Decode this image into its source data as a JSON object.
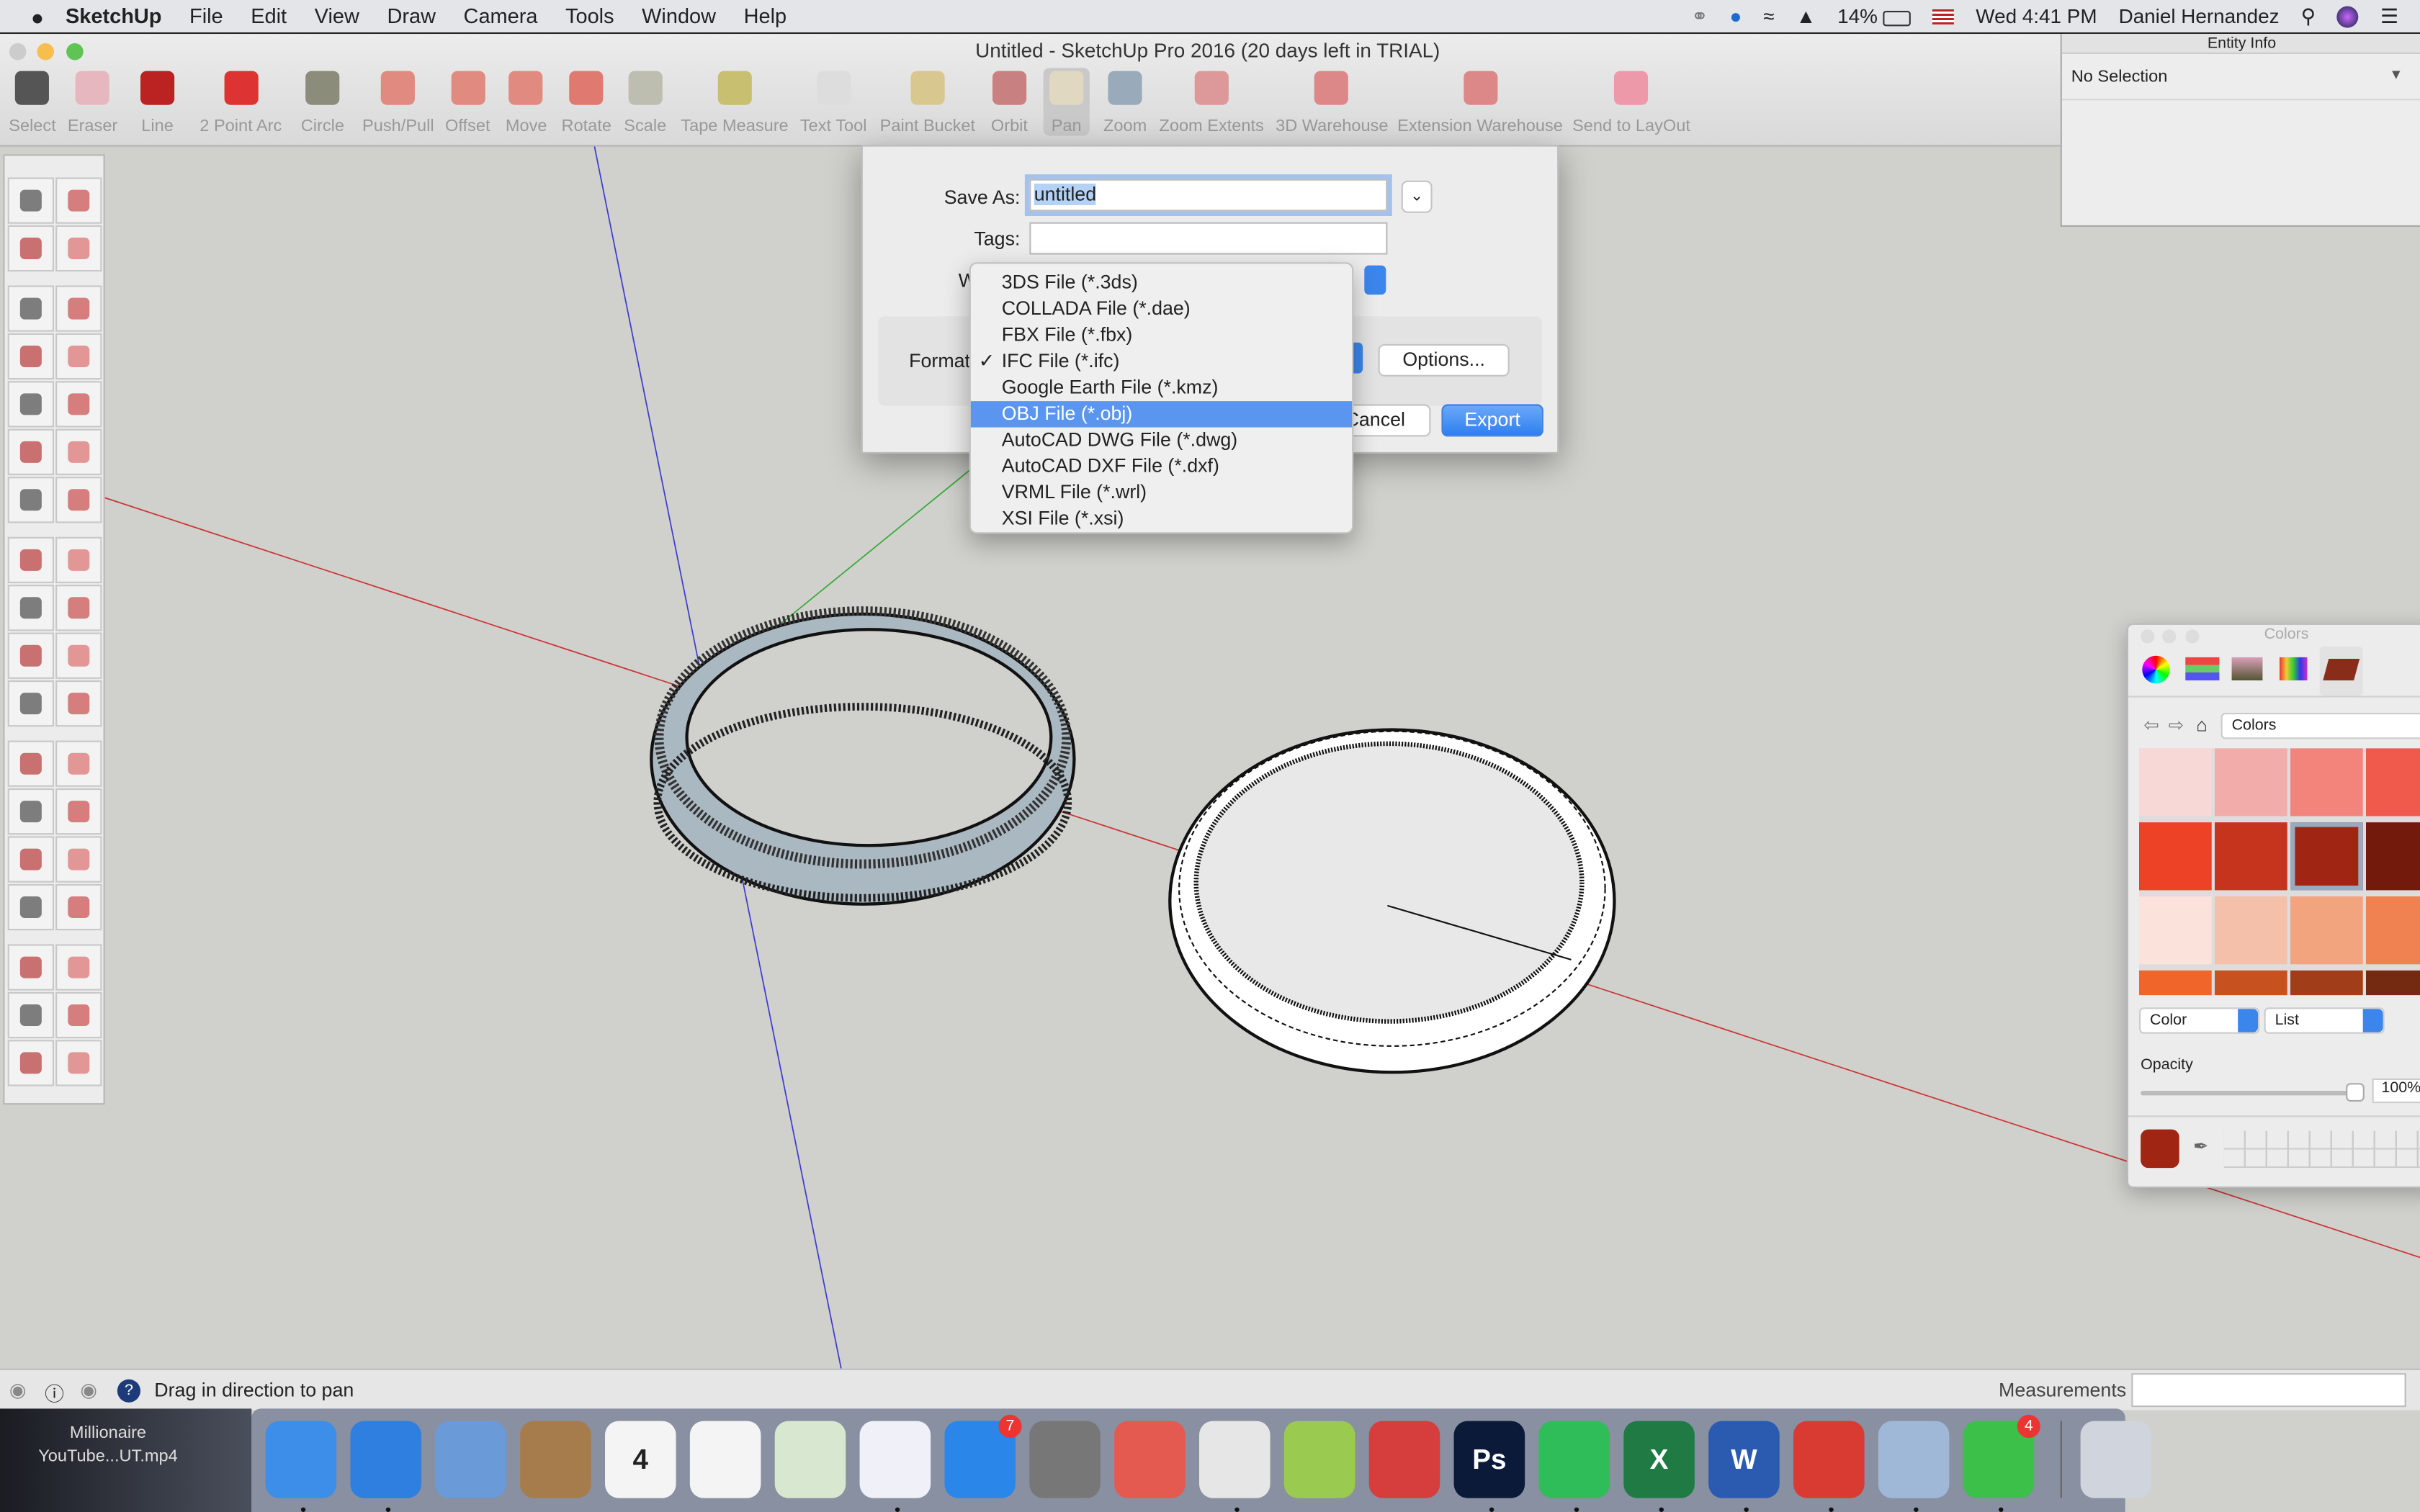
{
  "menubar": {
    "app": "SketchUp",
    "items": [
      "File",
      "Edit",
      "View",
      "Draw",
      "Camera",
      "Tools",
      "Window",
      "Help"
    ],
    "battery": "14%",
    "clock": "Wed 4:41 PM",
    "user": "Daniel Hernandez"
  },
  "window": {
    "title": "Untitled - SketchUp Pro 2016 (20 days left in TRIAL)"
  },
  "toolbar": [
    {
      "label": "Select",
      "icon": "select-arrow",
      "color": "#555"
    },
    {
      "label": "Eraser",
      "icon": "eraser",
      "color": "#e7b7c0"
    },
    {
      "label": "Line",
      "icon": "pencil",
      "color": "#b22"
    },
    {
      "label": "2 Point Arc",
      "icon": "arc",
      "color": "#d33"
    },
    {
      "label": "Circle",
      "icon": "circle",
      "color": "#8c8c7a"
    },
    {
      "label": "Push/Pull",
      "icon": "push-pull",
      "color": "#e08a80"
    },
    {
      "label": "Offset",
      "icon": "offset",
      "color": "#e08a80"
    },
    {
      "label": "Move",
      "icon": "move",
      "color": "#e08a80"
    },
    {
      "label": "Rotate",
      "icon": "rotate",
      "color": "#e07a70"
    },
    {
      "label": "Scale",
      "icon": "scale",
      "color": "#bdbdb0"
    },
    {
      "label": "Tape Measure",
      "icon": "tape-measure",
      "color": "#c8c070"
    },
    {
      "label": "Text Tool",
      "icon": "text",
      "color": "#ddd"
    },
    {
      "label": "Paint Bucket",
      "icon": "paint-bucket",
      "color": "#d8c890"
    },
    {
      "label": "Orbit",
      "icon": "orbit",
      "color": "#c98080"
    },
    {
      "label": "Pan",
      "icon": "pan-hand",
      "color": "#e0d8c0",
      "active": true
    },
    {
      "label": "Zoom",
      "icon": "zoom",
      "color": "#9ab"
    },
    {
      "label": "Zoom Extents",
      "icon": "zoom-extents",
      "color": "#d99"
    },
    {
      "label": "3D Warehouse",
      "icon": "warehouse",
      "color": "#d88"
    },
    {
      "label": "Extension Warehouse",
      "icon": "extension-warehouse",
      "color": "#d88"
    },
    {
      "label": "Send to LayOut",
      "icon": "send-layout",
      "color": "#e9a"
    }
  ],
  "entity_info": {
    "title": "Entity Info",
    "selection": "No Selection"
  },
  "palette": [
    "select",
    "component",
    "paint",
    "eraser",
    "line",
    "freehand",
    "rectangle",
    "rotated-rectangle",
    "circle",
    "polygon",
    "arc",
    "2pt-arc",
    "3pt-arc",
    "pie",
    "move",
    "push-pull",
    "rotate",
    "follow-me",
    "scale",
    "offset",
    "tape-measure",
    "dimension",
    "protractor",
    "text",
    "axes",
    "3d-text",
    "orbit",
    "pan",
    "zoom",
    "zoom-window",
    "zoom-extents",
    "previous",
    "position-camera",
    "walk",
    "look-around",
    "section-plane"
  ],
  "dialog": {
    "save_as_label": "Save As:",
    "save_as_value": "untitled",
    "tags_label": "Tags:",
    "where_label": "W",
    "format_label": "Format",
    "options": "Options...",
    "cancel": "Cancel",
    "export": "Export"
  },
  "format_menu": {
    "items": [
      "3DS File (*.3ds)",
      "COLLADA File (*.dae)",
      "FBX File (*.fbx)",
      "IFC File (*.ifc)",
      "Google Earth File (*.kmz)",
      "OBJ File (*.obj)",
      "AutoCAD DWG File (*.dwg)",
      "AutoCAD DXF File (*.dxf)",
      "VRML File (*.wrl)",
      "XSI File (*.xsi)"
    ],
    "checked": "IFC File (*.ifc)",
    "highlighted": "OBJ File (*.obj)"
  },
  "colors_panel": {
    "title": "Colors",
    "location": "Colors",
    "mode": "Color",
    "view": "List",
    "opacity_label": "Opacity",
    "opacity": "100%",
    "selected_color": "#a02613",
    "swatches": [
      "#f8d8d6",
      "#f2adab",
      "#f2847c",
      "#f05a4c",
      "#ee4226",
      "#c7341d",
      "#a02613",
      "#741a0c",
      "#fbe2da",
      "#f5c0aa",
      "#f2a47e",
      "#f08150",
      "#ef652a",
      "#c8521f",
      "#a13e19",
      "#742a10"
    ]
  },
  "statusbar": {
    "hint": "Drag in direction to pan",
    "measurements": "Measurements"
  },
  "desktop": {
    "file_label": "Millionaire YouTube...UT.mp4"
  },
  "dock": [
    {
      "name": "finder",
      "color": "#3d8ee8",
      "text": ""
    },
    {
      "name": "safari",
      "color": "#2e7fe0",
      "text": ""
    },
    {
      "name": "mail",
      "color": "#6a9ad8",
      "text": ""
    },
    {
      "name": "contacts",
      "color": "#a67c4c",
      "text": ""
    },
    {
      "name": "calendar",
      "color": "#f4f4f4",
      "text": "4"
    },
    {
      "name": "photos",
      "color": "#f4f4f4",
      "text": ""
    },
    {
      "name": "maps",
      "color": "#d8e8d0",
      "text": ""
    },
    {
      "name": "itunes",
      "color": "#f0f0f8",
      "text": ""
    },
    {
      "name": "app-store",
      "color": "#2a86e8",
      "text": "",
      "badge": "7"
    },
    {
      "name": "system-preferences",
      "color": "#777",
      "text": ""
    },
    {
      "name": "autocad",
      "color": "#e45a50",
      "text": ""
    },
    {
      "name": "chrome",
      "color": "#e6e6e6",
      "text": ""
    },
    {
      "name": "app-green",
      "color": "#9acb50",
      "text": ""
    },
    {
      "name": "autocad-2",
      "color": "#d63d3d",
      "text": ""
    },
    {
      "name": "photoshop",
      "color": "#0c1a3a",
      "text": "Ps"
    },
    {
      "name": "spotify",
      "color": "#2ebd59",
      "text": ""
    },
    {
      "name": "excel",
      "color": "#1f7a44",
      "text": "X"
    },
    {
      "name": "word",
      "color": "#2b5bb0",
      "text": "W"
    },
    {
      "name": "sketchup",
      "color": "#d93a32",
      "text": ""
    },
    {
      "name": "preview",
      "color": "#a0b8d8",
      "text": ""
    },
    {
      "name": "whatsapp",
      "color": "#3cc04a",
      "text": "",
      "badge": "4"
    },
    {
      "name": "trash",
      "color": "#d0d4dc",
      "text": ""
    }
  ]
}
